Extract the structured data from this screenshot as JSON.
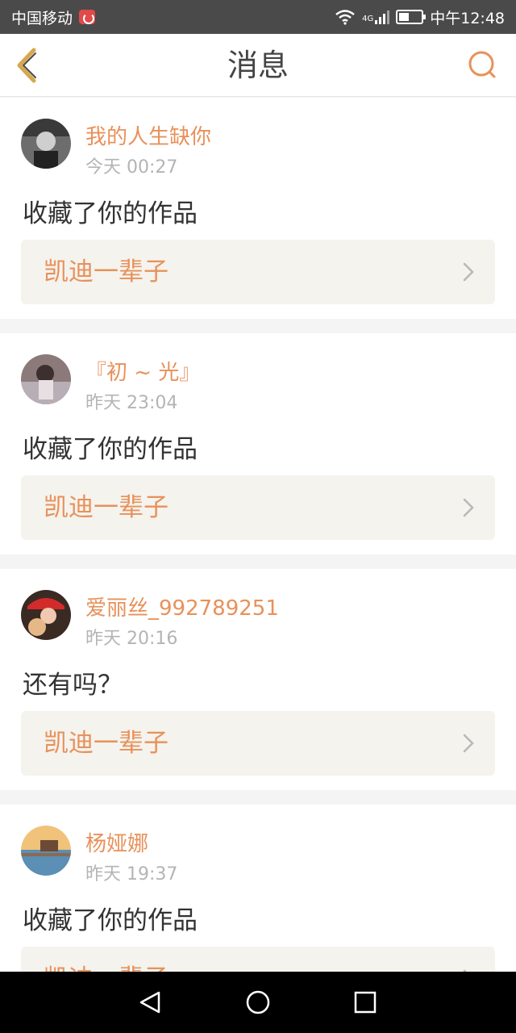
{
  "status_bar": {
    "carrier": "中国移动",
    "network": "4G",
    "time": "中午12:48"
  },
  "header": {
    "title": "消息",
    "back_icon": "back-chevron-icon",
    "search_icon": "search-icon"
  },
  "colors": {
    "accent": "#e8915a",
    "text_primary": "#333333",
    "text_secondary": "#b4b4b4",
    "card_link_bg": "#f4f3ee"
  },
  "messages": [
    {
      "username": "我的人生缺你",
      "time": "今天 00:27",
      "action": "收藏了你的作品",
      "work_title": "凯迪一辈子"
    },
    {
      "username": "『初 ~ 光』",
      "time": "昨天 23:04",
      "action": "收藏了你的作品",
      "work_title": "凯迪一辈子"
    },
    {
      "username": "爱丽丝_992789251",
      "time": "昨天 20:16",
      "action": "还有吗？",
      "work_title": "凯迪一辈子"
    },
    {
      "username": "杨娅娜",
      "time": "昨天 19:37",
      "action": "收藏了你的作品",
      "work_title": "凯迪一辈子"
    }
  ]
}
